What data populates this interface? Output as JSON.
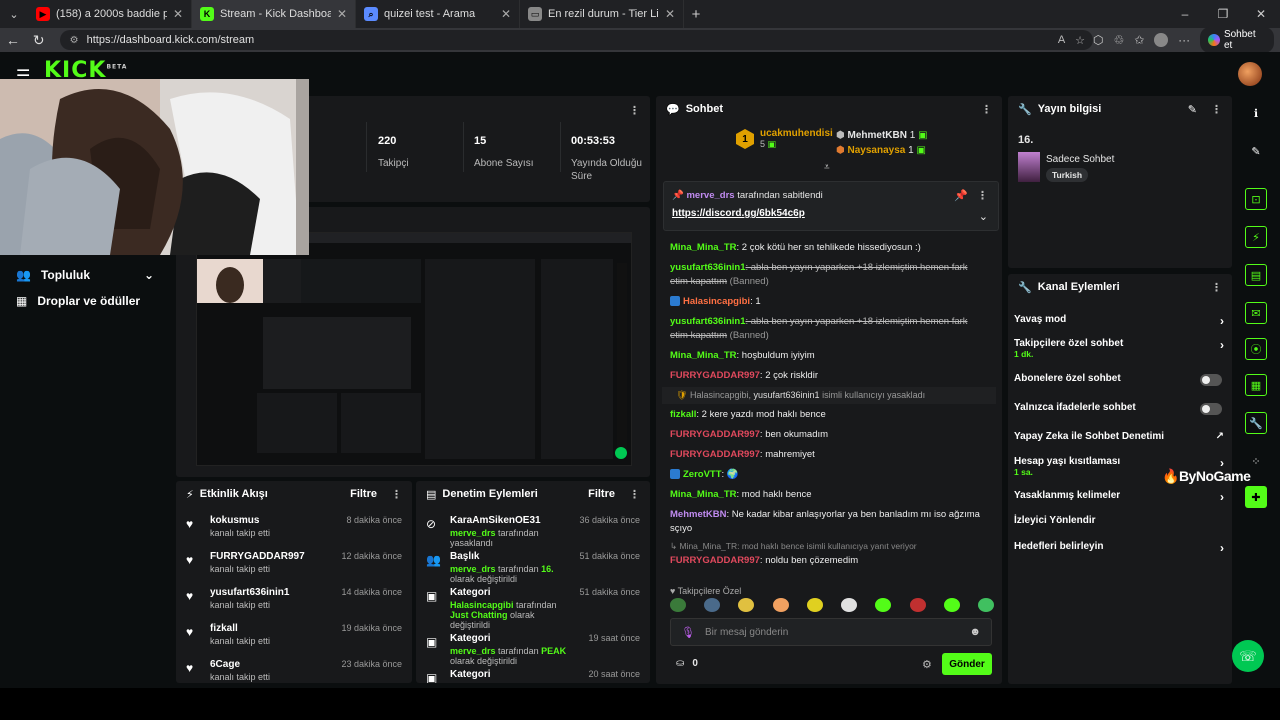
{
  "browser": {
    "tabs": [
      {
        "title": "(158) a 2000s baddie playlist",
        "fav": "▶",
        "favColor": "#ff0000"
      },
      {
        "title": "Stream - Kick Dashboard",
        "fav": "K",
        "favColor": "#53fc18",
        "active": true
      },
      {
        "title": "quizei test - Arama",
        "fav": "⌕",
        "favColor": "#5b8bff"
      },
      {
        "title": "En rezil durum - Tier List, Kör Sıral...",
        "fav": "▭",
        "favColor": "#888"
      }
    ],
    "url": "https://dashboard.kick.com/stream",
    "profile_button": "Sohbet et"
  },
  "app": {
    "logo": "KICK",
    "logo_sup": "BETA",
    "sidebar": [
      {
        "label": "Topluluk",
        "icon": "people-icon",
        "expandable": true
      },
      {
        "label": "Droplar ve ödüller",
        "icon": "gift-icon"
      }
    ],
    "stats": [
      {
        "value": "220",
        "label": "Takipçi"
      },
      {
        "value": "15",
        "label": "Abone Sayısı"
      },
      {
        "value": "00:53:53",
        "label": "Yayında Olduğu Süre"
      }
    ],
    "activity": {
      "title": "Etkinlik Akışı",
      "filter": "Filtre",
      "items": [
        {
          "name": "kokusmus",
          "sub": "kanalı takip etti",
          "time": "8 dakika önce"
        },
        {
          "name": "FURRYGADDAR997",
          "sub": "kanalı takip etti",
          "time": "12 dakika önce"
        },
        {
          "name": "yusufart636inin1",
          "sub": "kanalı takip etti",
          "time": "14 dakika önce"
        },
        {
          "name": "fizkall",
          "sub": "kanalı takip etti",
          "time": "19 dakika önce"
        },
        {
          "name": "6Cage",
          "sub": "kanalı takip etti",
          "time": "23 dakika önce"
        }
      ]
    },
    "moderation": {
      "title": "Denetim Eylemleri",
      "filter": "Filtre",
      "items": [
        {
          "name": "KaraAmSikenOE31",
          "sub_user": "merve_drs",
          "sub_text": " tarafından yasaklandı",
          "time": "36 dakika önce",
          "icon": "ban-icon"
        },
        {
          "name": "Başlık",
          "sub_user": "merve_drs",
          "sub_text": " tarafından ",
          "sub_extra": "16.",
          "sub_tail": " olarak değiştirildi",
          "time": "51 dakika önce",
          "icon": "title-icon"
        },
        {
          "name": "Kategori",
          "sub_user": "Halasincapgibi",
          "sub_text": " tarafından ",
          "sub_extra": "Just Chatting",
          "sub_tail": " olarak değiştirildi",
          "time": "51 dakika önce",
          "icon": "category-icon"
        },
        {
          "name": "Kategori",
          "sub_user": "merve_drs",
          "sub_text": " tarafından ",
          "sub_extra": "PEAK",
          "sub_tail": " olarak değiştirildi",
          "time": "19 saat önce",
          "icon": "category-icon"
        },
        {
          "name": "Kategori",
          "sub_user": "",
          "sub_text": "",
          "time": "20 saat önce",
          "icon": "category-icon"
        }
      ]
    },
    "chat": {
      "title": "Sohbet",
      "top_gifters": [
        {
          "name": "ucakmuhendisi",
          "count": "5",
          "rank": "1"
        },
        {
          "name": "MehmetKBN",
          "count": "1"
        },
        {
          "name": "Naysanaysa",
          "count": "1"
        }
      ],
      "pinned": {
        "user": "merve_drs",
        "text": "tarafından sabitlendi",
        "link": "https://discord.gg/6bk54c6p"
      },
      "messages": [
        {
          "user": "Mina_Mina_TR",
          "color": "u-green",
          "text": ": 2 çok kötü her sn tehlikede hissediyosun :)"
        },
        {
          "user": "yusufart636inin1",
          "color": "u-green",
          "text": ": abla ben yayın yaparken +18 izlemiştim hemen fark etim kapattım",
          "strike": true,
          "banned": "(Banned)"
        },
        {
          "user": "Halasincapgibi",
          "color": "u-orange",
          "text": ": 1",
          "badge": true
        },
        {
          "user": "yusufart636inin1",
          "color": "u-green",
          "text": ": abla ben yayın yaparken +18 izlemiştim hemen fark etim kapattım",
          "strike": true,
          "banned": "(Banned)"
        },
        {
          "user": "Mina_Mina_TR",
          "color": "u-green",
          "text": ": hoşbuldum iyiyim"
        },
        {
          "user": "FURRYGADDAR997",
          "color": "u-red",
          "text": ": 2 çok riskldir"
        }
      ],
      "system1": {
        "user": "Halasincapgibi",
        "target": "yusufart636inin1",
        "text": " isimli kullanıcıyı yasakladı"
      },
      "messages2": [
        {
          "user": "fizkall",
          "color": "u-green",
          "text": ": 2 kere yazdı mod haklı bence"
        },
        {
          "user": "FURRYGADDAR997",
          "color": "u-red",
          "text": ": ben okumadım"
        },
        {
          "user": "FURRYGADDAR997",
          "color": "u-red",
          "text": ": mahremiyet"
        },
        {
          "user": "ZeroVTT",
          "color": "u-green",
          "text": ": 🌍",
          "badge": true
        },
        {
          "user": "Mina_Mina_TR",
          "color": "u-green",
          "text": ": mod haklı bence"
        },
        {
          "user": "MehmetKBN",
          "color": "u-purple",
          "text": ": Ne kadar kibar anlaşıyorlar ya ben banladım mı iso ağzıma sçıyo"
        }
      ],
      "reply_hint": "↳ Mina_Mina_TR: mod haklı bence isimli kullanıcıya yanıt veriyor",
      "reply_msg": {
        "user": "FURRYGADDAR997",
        "text": ": noldu ben çözemedim"
      },
      "followers_only": "♥ Takipçilere Özel",
      "input_placeholder": "Bir mesaj gönderin",
      "points": "0",
      "send": "Gönder"
    },
    "stream_info": {
      "title": "Yayın bilgisi",
      "stream_title": "16.",
      "category": "Sadece Sohbet",
      "tag": "Turkish"
    },
    "channel_actions": {
      "title": "Kanal Eylemleri",
      "items": [
        {
          "label": "Yavaş mod",
          "kind": "arrow"
        },
        {
          "label": "Takipçilere özel sohbet",
          "sub": "1 dk.",
          "kind": "arrow"
        },
        {
          "label": "Abonelere özel sohbet",
          "kind": "toggle"
        },
        {
          "label": "Yalnızca ifadelerle sohbet",
          "kind": "toggle"
        },
        {
          "label": "Yapay Zeka ile Sohbet Denetimi",
          "kind": "external"
        },
        {
          "label": "Hesap yaşı kısıtlaması",
          "sub": "1 sa.",
          "kind": "arrow"
        },
        {
          "label": "Yasaklanmış kelimeler",
          "kind": "arrow"
        },
        {
          "label": "İzleyici Yönlendir",
          "kind": "none"
        },
        {
          "label": "Hedefleri belirleyin",
          "kind": "arrow"
        }
      ]
    },
    "watermark": "ByNoGame"
  },
  "colors": {
    "accent": "#53fc18",
    "panel": "#18191b",
    "bg": "#0b0e0f"
  }
}
